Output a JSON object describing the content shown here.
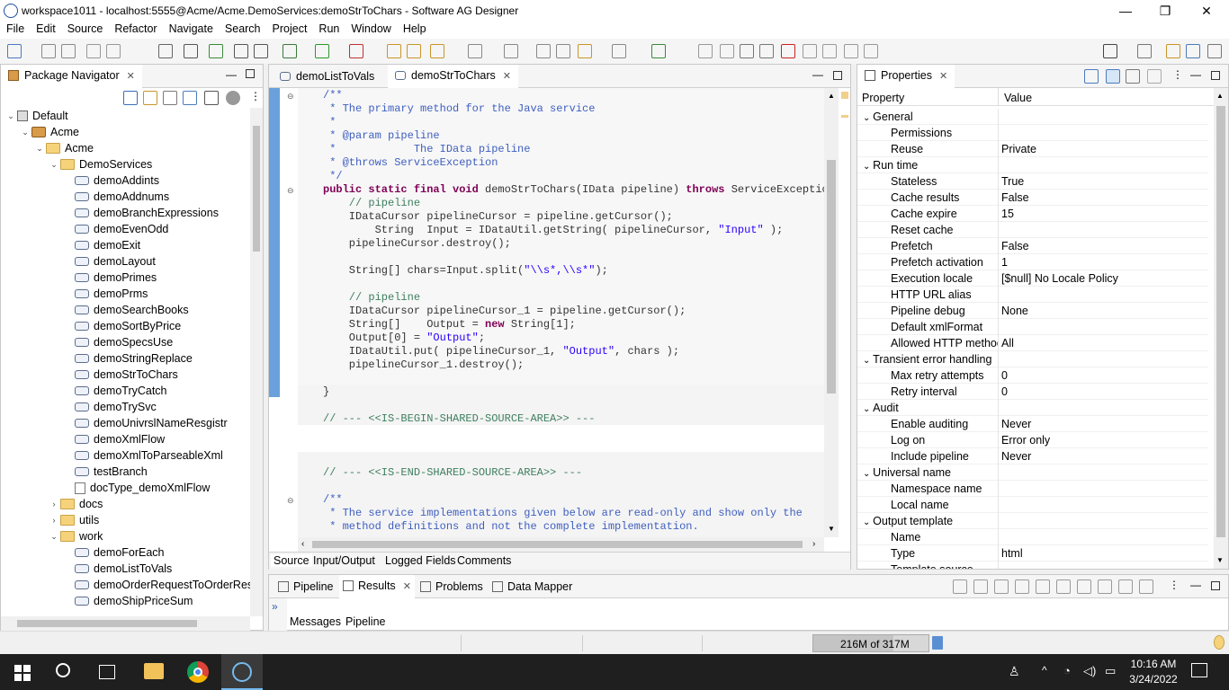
{
  "window": {
    "title": "workspace1011 - localhost:5555@Acme/Acme.DemoServices:demoStrToChars - Software AG Designer",
    "minimize": "—",
    "restore": "❐",
    "close": "✕"
  },
  "menu": [
    "File",
    "Edit",
    "Source",
    "Refactor",
    "Navigate",
    "Search",
    "Project",
    "Run",
    "Window",
    "Help"
  ],
  "navigator": {
    "tab_label": "Package Navigator",
    "close": "✕",
    "items": [
      {
        "label": "Default",
        "type": "server",
        "indent": 0,
        "twisty": "⌄"
      },
      {
        "label": "Acme",
        "type": "pkg",
        "indent": 1,
        "twisty": "⌄"
      },
      {
        "label": "Acme",
        "type": "folder",
        "indent": 2,
        "twisty": "⌄"
      },
      {
        "label": "DemoServices",
        "type": "folder",
        "indent": 3,
        "twisty": "⌄"
      },
      {
        "label": "demoAddints",
        "type": "svc",
        "indent": 4,
        "twisty": ""
      },
      {
        "label": "demoAddnums",
        "type": "svc",
        "indent": 4,
        "twisty": ""
      },
      {
        "label": "demoBranchExpressions",
        "type": "svc",
        "indent": 4,
        "twisty": ""
      },
      {
        "label": "demoEvenOdd",
        "type": "svc",
        "indent": 4,
        "twisty": ""
      },
      {
        "label": "demoExit",
        "type": "svc",
        "indent": 4,
        "twisty": ""
      },
      {
        "label": "demoLayout",
        "type": "svc",
        "indent": 4,
        "twisty": ""
      },
      {
        "label": "demoPrimes",
        "type": "svc",
        "indent": 4,
        "twisty": ""
      },
      {
        "label": "demoPrms",
        "type": "svc",
        "indent": 4,
        "twisty": ""
      },
      {
        "label": "demoSearchBooks",
        "type": "svc",
        "indent": 4,
        "twisty": ""
      },
      {
        "label": "demoSortByPrice",
        "type": "svc",
        "indent": 4,
        "twisty": ""
      },
      {
        "label": "demoSpecsUse",
        "type": "svc",
        "indent": 4,
        "twisty": ""
      },
      {
        "label": "demoStringReplace",
        "type": "svc",
        "indent": 4,
        "twisty": ""
      },
      {
        "label": "demoStrToChars",
        "type": "svc",
        "indent": 4,
        "twisty": ""
      },
      {
        "label": "demoTryCatch",
        "type": "svc",
        "indent": 4,
        "twisty": ""
      },
      {
        "label": "demoTrySvc",
        "type": "svc",
        "indent": 4,
        "twisty": ""
      },
      {
        "label": "demoUnivrslNameResgistr",
        "type": "svc",
        "indent": 4,
        "twisty": ""
      },
      {
        "label": "demoXmlFlow",
        "type": "svc",
        "indent": 4,
        "twisty": ""
      },
      {
        "label": "demoXmlToParseableXml",
        "type": "svc",
        "indent": 4,
        "twisty": ""
      },
      {
        "label": "testBranch",
        "type": "svc",
        "indent": 4,
        "twisty": ""
      },
      {
        "label": "docType_demoXmlFlow",
        "type": "doc",
        "indent": 4,
        "twisty": ""
      },
      {
        "label": "docs",
        "type": "folder",
        "indent": 3,
        "twisty": "›"
      },
      {
        "label": "utils",
        "type": "folder",
        "indent": 3,
        "twisty": "›"
      },
      {
        "label": "work",
        "type": "folder",
        "indent": 3,
        "twisty": "⌄"
      },
      {
        "label": "demoForEach",
        "type": "svc",
        "indent": 4,
        "twisty": ""
      },
      {
        "label": "demoListToVals",
        "type": "svc",
        "indent": 4,
        "twisty": ""
      },
      {
        "label": "demoOrderRequestToOrderResp",
        "type": "svc",
        "indent": 4,
        "twisty": ""
      },
      {
        "label": "demoShipPriceSum",
        "type": "svc",
        "indent": 4,
        "twisty": ""
      }
    ]
  },
  "editor": {
    "tabs": [
      {
        "label": "demoListToVals",
        "active": false
      },
      {
        "label": "demoStrToChars",
        "active": true
      }
    ],
    "code_lines": [
      [
        [
          "c-com",
          "/**"
        ]
      ],
      [
        [
          "c-com",
          " * The primary method for the Java service"
        ]
      ],
      [
        [
          "c-com",
          " *"
        ]
      ],
      [
        [
          "c-com",
          " * @param pipeline"
        ]
      ],
      [
        [
          "c-com",
          " *            The IData pipeline"
        ]
      ],
      [
        [
          "c-com",
          " * @throws ServiceException"
        ]
      ],
      [
        [
          "c-com",
          " */"
        ]
      ],
      [
        [
          "c-kw",
          "public static final void "
        ],
        [
          "c-id",
          "demoStrToChars(IData pipeline) "
        ],
        [
          "c-kw",
          "throws "
        ],
        [
          "c-id",
          "ServiceException {"
        ]
      ],
      [
        [
          "c-com2",
          "    // pipeline"
        ]
      ],
      [
        [
          "c-id",
          "    IDataCursor pipelineCursor = pipeline.getCursor();"
        ]
      ],
      [
        [
          "c-id",
          "        String  Input = IDataUtil.getString( pipelineCursor, "
        ],
        [
          "c-str",
          "\"Input\""
        ],
        [
          "c-id",
          " );"
        ]
      ],
      [
        [
          "c-id",
          "    pipelineCursor.destroy();"
        ]
      ],
      [
        [
          "c-id",
          ""
        ]
      ],
      [
        [
          "c-id",
          "    String[] chars=Input.split("
        ],
        [
          "c-str",
          "\"\\\\s*,\\\\s*\""
        ],
        [
          "c-id",
          ");"
        ]
      ],
      [
        [
          "c-id",
          ""
        ]
      ],
      [
        [
          "c-com2",
          "    // pipeline"
        ]
      ],
      [
        [
          "c-id",
          "    IDataCursor pipelineCursor_1 = pipeline.getCursor();"
        ]
      ],
      [
        [
          "c-id",
          "    String[]    Output = "
        ],
        [
          "c-kw",
          "new "
        ],
        [
          "c-id",
          "String[1];"
        ]
      ],
      [
        [
          "c-id",
          "    Output[0] = "
        ],
        [
          "c-str",
          "\"Output\""
        ],
        [
          "c-id",
          ";"
        ]
      ],
      [
        [
          "c-id",
          "    IDataUtil.put( pipelineCursor_1, "
        ],
        [
          "c-str",
          "\"Output\""
        ],
        [
          "c-id",
          ", chars );"
        ]
      ],
      [
        [
          "c-id",
          "    pipelineCursor_1.destroy();"
        ]
      ],
      [
        [
          "c-id",
          ""
        ]
      ],
      [
        [
          "c-id",
          "}"
        ]
      ],
      [
        [
          "c-id",
          ""
        ]
      ],
      [
        [
          "c-com2",
          "// --- <<IS-BEGIN-SHARED-SOURCE-AREA>> ---"
        ]
      ],
      [
        [
          "c-id",
          ""
        ]
      ],
      [
        [
          "c-id",
          ""
        ]
      ],
      [
        [
          "c-id",
          ""
        ]
      ],
      [
        [
          "c-com2",
          "// --- <<IS-END-SHARED-SOURCE-AREA>> ---"
        ]
      ],
      [
        [
          "c-id",
          ""
        ]
      ],
      [
        [
          "c-com",
          "/**"
        ]
      ],
      [
        [
          "c-com",
          " * The service implementations given below are read-only and show only the"
        ]
      ],
      [
        [
          "c-com",
          " * method definitions and not the complete implementation."
        ]
      ]
    ],
    "bottom_tabs": [
      "Source",
      "Input/Output",
      "Logged Fields",
      "Comments"
    ]
  },
  "properties": {
    "tab_label": "Properties",
    "col_property": "Property",
    "col_value": "Value",
    "rows": [
      {
        "name": "General",
        "value": "",
        "group": true
      },
      {
        "name": "Permissions",
        "value": "",
        "group": false
      },
      {
        "name": "Reuse",
        "value": "Private",
        "group": false
      },
      {
        "name": "Run time",
        "value": "",
        "group": true
      },
      {
        "name": "Stateless",
        "value": "True",
        "group": false
      },
      {
        "name": "Cache results",
        "value": "False",
        "group": false
      },
      {
        "name": "Cache expire",
        "value": "15",
        "group": false
      },
      {
        "name": "Reset cache",
        "value": "",
        "group": false
      },
      {
        "name": "Prefetch",
        "value": "False",
        "group": false
      },
      {
        "name": "Prefetch activation",
        "value": "1",
        "group": false
      },
      {
        "name": "Execution locale",
        "value": "[$null] No Locale Policy",
        "group": false
      },
      {
        "name": "HTTP URL alias",
        "value": "",
        "group": false
      },
      {
        "name": "Pipeline debug",
        "value": "None",
        "group": false
      },
      {
        "name": "Default xmlFormat",
        "value": "",
        "group": false
      },
      {
        "name": "Allowed HTTP methods",
        "value": "All",
        "group": false
      },
      {
        "name": "Transient error handling",
        "value": "",
        "group": true
      },
      {
        "name": "Max retry attempts",
        "value": "0",
        "group": false
      },
      {
        "name": "Retry interval",
        "value": "0",
        "group": false
      },
      {
        "name": "Audit",
        "value": "",
        "group": true
      },
      {
        "name": "Enable auditing",
        "value": "Never",
        "group": false
      },
      {
        "name": "Log on",
        "value": "Error only",
        "group": false
      },
      {
        "name": "Include pipeline",
        "value": "Never",
        "group": false
      },
      {
        "name": "Universal name",
        "value": "",
        "group": true
      },
      {
        "name": "Namespace name",
        "value": "",
        "group": false
      },
      {
        "name": "Local name",
        "value": "",
        "group": false
      },
      {
        "name": "Output template",
        "value": "",
        "group": true
      },
      {
        "name": "Name",
        "value": "",
        "group": false
      },
      {
        "name": "Type",
        "value": "html",
        "group": false
      },
      {
        "name": "Template source",
        "value": "",
        "group": false
      }
    ]
  },
  "results": {
    "tabs": [
      "Pipeline",
      "Results",
      "Problems",
      "Data Mapper"
    ],
    "sub_tabs": [
      "Messages",
      "Pipeline"
    ]
  },
  "status": {
    "memory": "216M of 317M"
  },
  "taskbar": {
    "time": "10:16 AM",
    "date": "3/24/2022"
  },
  "colors": {
    "accent": "#2a5caa",
    "task_bg": "#1f1f1f"
  }
}
